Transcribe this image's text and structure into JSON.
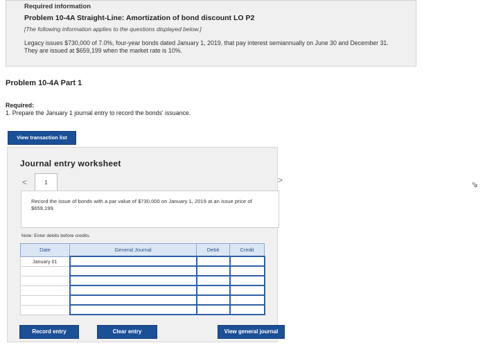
{
  "required_info": {
    "heading": "Required information",
    "problem_title": "Problem 10-4A Straight-Line: Amortization of bond discount LO P2",
    "note": "[The following information applies to the questions displayed below.]",
    "description": "Legacy issues $730,000 of 7.0%, four-year bonds dated January 1, 2019, that pay interest semiannually on June 30 and December 31. They are issued at $659,199 when the market rate is 10%."
  },
  "part": {
    "title": "Problem 10-4A Part 1"
  },
  "required": {
    "label": "Required:",
    "item": "1. Prepare the January 1 journal entry to record the bonds' issuance."
  },
  "buttons": {
    "view_transaction": "View transaction list",
    "record_entry": "Record entry",
    "clear_entry": "Clear entry",
    "view_general_journal": "View general journal"
  },
  "worksheet": {
    "title": "Journal entry worksheet",
    "tab_number": "1",
    "prev_arrow": "<",
    "next_arrow": ">",
    "instruction": "Record the issue of bonds with a par value of $730,000 on January 1, 2019 at an issue price of $659,199.",
    "note": "Note: Enter debits before credits.",
    "columns": [
      "Date",
      "General Journal",
      "Debit",
      "Credit"
    ],
    "rows": [
      {
        "date": "January 01"
      },
      {
        "date": ""
      },
      {
        "date": ""
      },
      {
        "date": ""
      },
      {
        "date": ""
      },
      {
        "date": ""
      }
    ]
  }
}
